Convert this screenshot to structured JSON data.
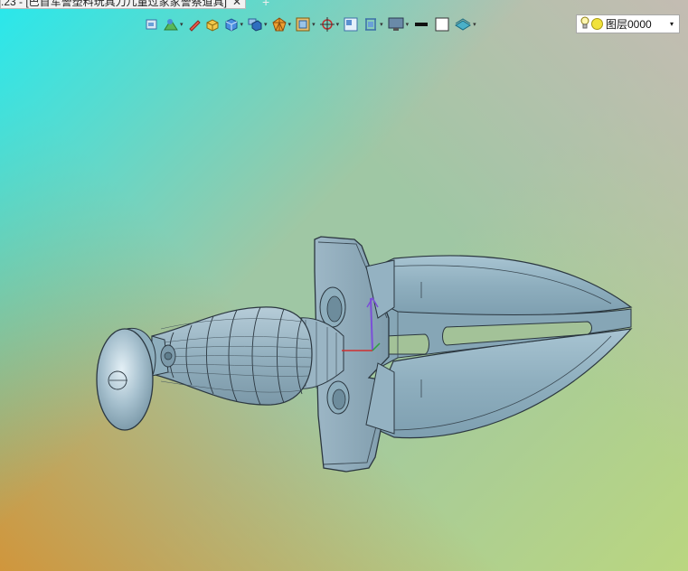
{
  "window": {
    "doc_tab_title": ".23 - [巴首军警塑料玩具刀儿童过家家警察道具]",
    "close_glyph": "✕",
    "new_tab_glyph": "+"
  },
  "toolbar": {
    "icons": [
      "view-icon",
      "draft-icon",
      "pencil-icon",
      "box-icon",
      "cube-icon",
      "render-icon",
      "sphere-wire-icon",
      "shaded-icon",
      "axis-icon",
      "window-icon",
      "plane-icon",
      "monitor-icon",
      "line-color-icon",
      "fill-color-icon",
      "layer-display-icon"
    ],
    "dropdown_glyph": "▾"
  },
  "layer": {
    "name": "图层0000",
    "bulb_color": "#f1e23a",
    "dropdown_glyph": "▾"
  },
  "colors": {
    "model_fill": "#8fb0c0",
    "model_edge": "#2b3740"
  }
}
